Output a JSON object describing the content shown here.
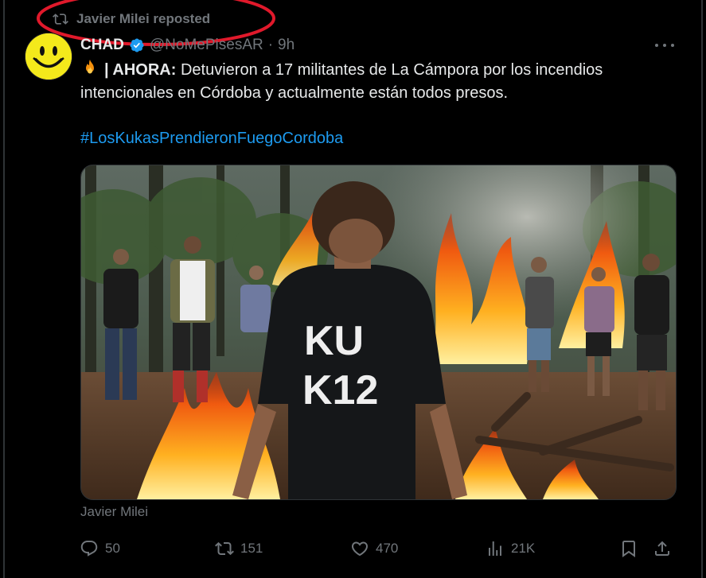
{
  "repost": {
    "label": "Javier Milei reposted"
  },
  "author": {
    "name": "CHAD",
    "handle": "@NoMePisesAR",
    "separator": "·",
    "time": "9h"
  },
  "tweet": {
    "emoji": "fire-icon",
    "prefix_bold": "| AHORA:",
    "body": "Detuvieron a 17 militantes de La Cámpora por los incendios intencionales en Córdoba y actualmente están todos presos.",
    "hashtag": "#LosKukasPrendieronFuegoCordoba"
  },
  "media": {
    "shirt_text_line1": "KU",
    "shirt_text_line2": "K12",
    "attribution": "Javier Milei"
  },
  "actions": {
    "replies": "50",
    "reposts": "151",
    "likes": "470",
    "views": "21K"
  },
  "colors": {
    "background": "#000000",
    "muted": "#71767b",
    "link": "#1d9bf0",
    "verified": "#1d9bf0",
    "annotation": "#e0192b"
  }
}
